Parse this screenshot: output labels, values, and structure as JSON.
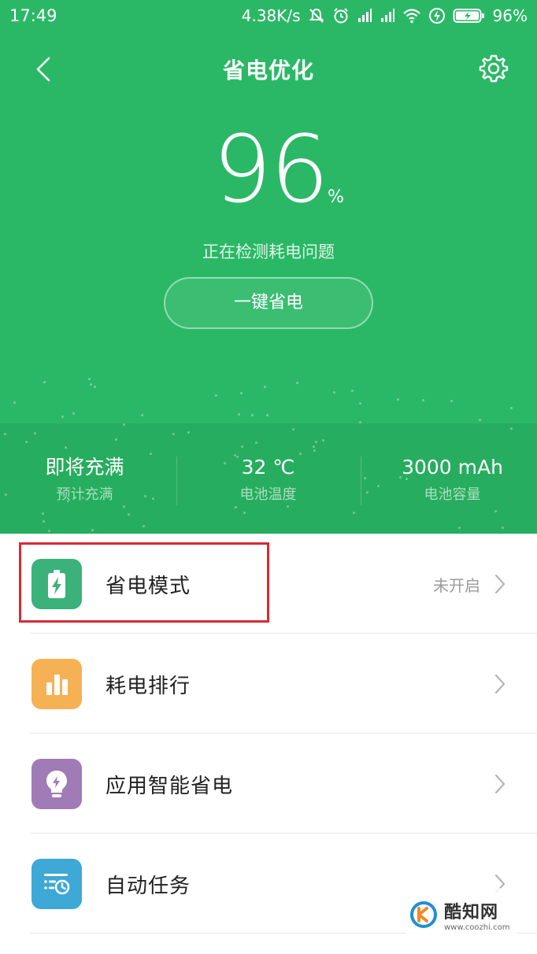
{
  "status_bar": {
    "time": "17:49",
    "network_speed": "4.38K/s",
    "battery_percent": "96%",
    "icons": [
      "mute-icon",
      "alarm-icon",
      "signal-icon",
      "signal-icon",
      "wifi-icon",
      "charging-icon",
      "battery-icon"
    ]
  },
  "header": {
    "title": "省电优化"
  },
  "battery": {
    "level": "96",
    "unit": "%",
    "detect_text": "正在检测耗电问题",
    "save_button_label": "一键省电"
  },
  "stats": [
    {
      "value": "即将充满",
      "label": "预计充满"
    },
    {
      "value": "32 ℃",
      "label": "电池温度"
    },
    {
      "value": "3000 mAh",
      "label": "电池容量"
    }
  ],
  "menu": [
    {
      "label": "省电模式",
      "status": "未开启",
      "icon": "battery-bolt-icon",
      "icon_color": "#3bb27a"
    },
    {
      "label": "耗电排行",
      "status": "",
      "icon": "bar-chart-icon",
      "icon_color": "#f6b155"
    },
    {
      "label": "应用智能省电",
      "status": "",
      "icon": "bulb-icon",
      "icon_color": "#a07bb6"
    },
    {
      "label": "自动任务",
      "status": "",
      "icon": "task-clock-icon",
      "icon_color": "#3ea8d6"
    }
  ],
  "watermark": {
    "name": "酷知网",
    "url": "www.coozhi.com"
  },
  "colors": {
    "hero_green": "#2bb866",
    "hero_green_dark": "#27ad5f",
    "highlight_red": "#d62b34"
  }
}
